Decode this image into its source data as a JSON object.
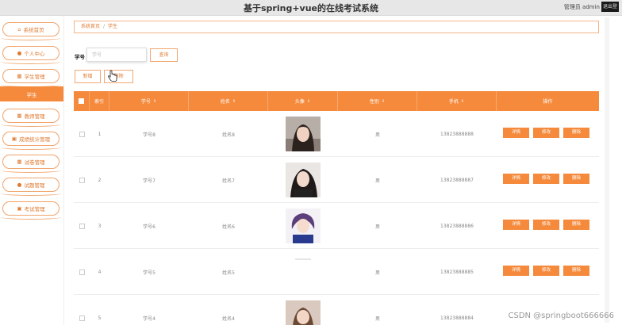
{
  "header": {
    "title": "基于spring+vue的在线考试系统",
    "admin_text": "管理员 admin",
    "logout_label": "退出登录"
  },
  "sidebar": {
    "items": [
      {
        "label": "系统首页",
        "icon": "home-icon",
        "glyph": "⌂"
      },
      {
        "label": "个人中心",
        "icon": "user-icon",
        "glyph": "●"
      },
      {
        "label": "学生管理",
        "icon": "grid-icon",
        "glyph": "▦"
      },
      {
        "label": "教师管理",
        "icon": "grid-icon",
        "glyph": "▦"
      },
      {
        "label": "成绩统计管理",
        "icon": "bag-icon",
        "glyph": "▣"
      },
      {
        "label": "试卷管理",
        "icon": "grid-icon",
        "glyph": "▦"
      },
      {
        "label": "试题管理",
        "icon": "user-icon",
        "glyph": "●"
      },
      {
        "label": "考试管理",
        "icon": "bag-icon",
        "glyph": "▣"
      }
    ],
    "active_label": "学生"
  },
  "breadcrumb": {
    "home": "系统首页",
    "separator": "/",
    "current": "学生"
  },
  "search": {
    "label": "学号",
    "placeholder": "学号",
    "value": "",
    "query_label": "查询"
  },
  "toolbar": {
    "add_label": "新增",
    "delete_label": "删除"
  },
  "table": {
    "columns": [
      "索引",
      "学号",
      "姓名",
      "头像",
      "性别",
      "手机",
      "操作"
    ],
    "sortable": [
      false,
      true,
      true,
      true,
      true,
      true,
      false
    ],
    "action_labels": [
      "详情",
      "修改",
      "删除"
    ],
    "rows": [
      {
        "index": "1",
        "student_id": "学号8",
        "name": "姓名8",
        "avatar": "photo",
        "gender": "男",
        "phone": "13823888888"
      },
      {
        "index": "2",
        "student_id": "学号7",
        "name": "姓名7",
        "avatar": "photo",
        "gender": "男",
        "phone": "13823888887"
      },
      {
        "index": "3",
        "student_id": "学号6",
        "name": "姓名6",
        "avatar": "photo",
        "gender": "男",
        "phone": "13823888886"
      },
      {
        "index": "4",
        "student_id": "学号5",
        "name": "姓名5",
        "avatar": "none",
        "gender": "男",
        "phone": "13823888885"
      },
      {
        "index": "5",
        "student_id": "学号4",
        "name": "姓名4",
        "avatar": "photo",
        "gender": "男",
        "phone": "13823888884"
      }
    ]
  },
  "colors": {
    "accent": "#f58a3c",
    "accent_light": "#f3a672"
  },
  "watermark": "CSDN @springboot666666"
}
